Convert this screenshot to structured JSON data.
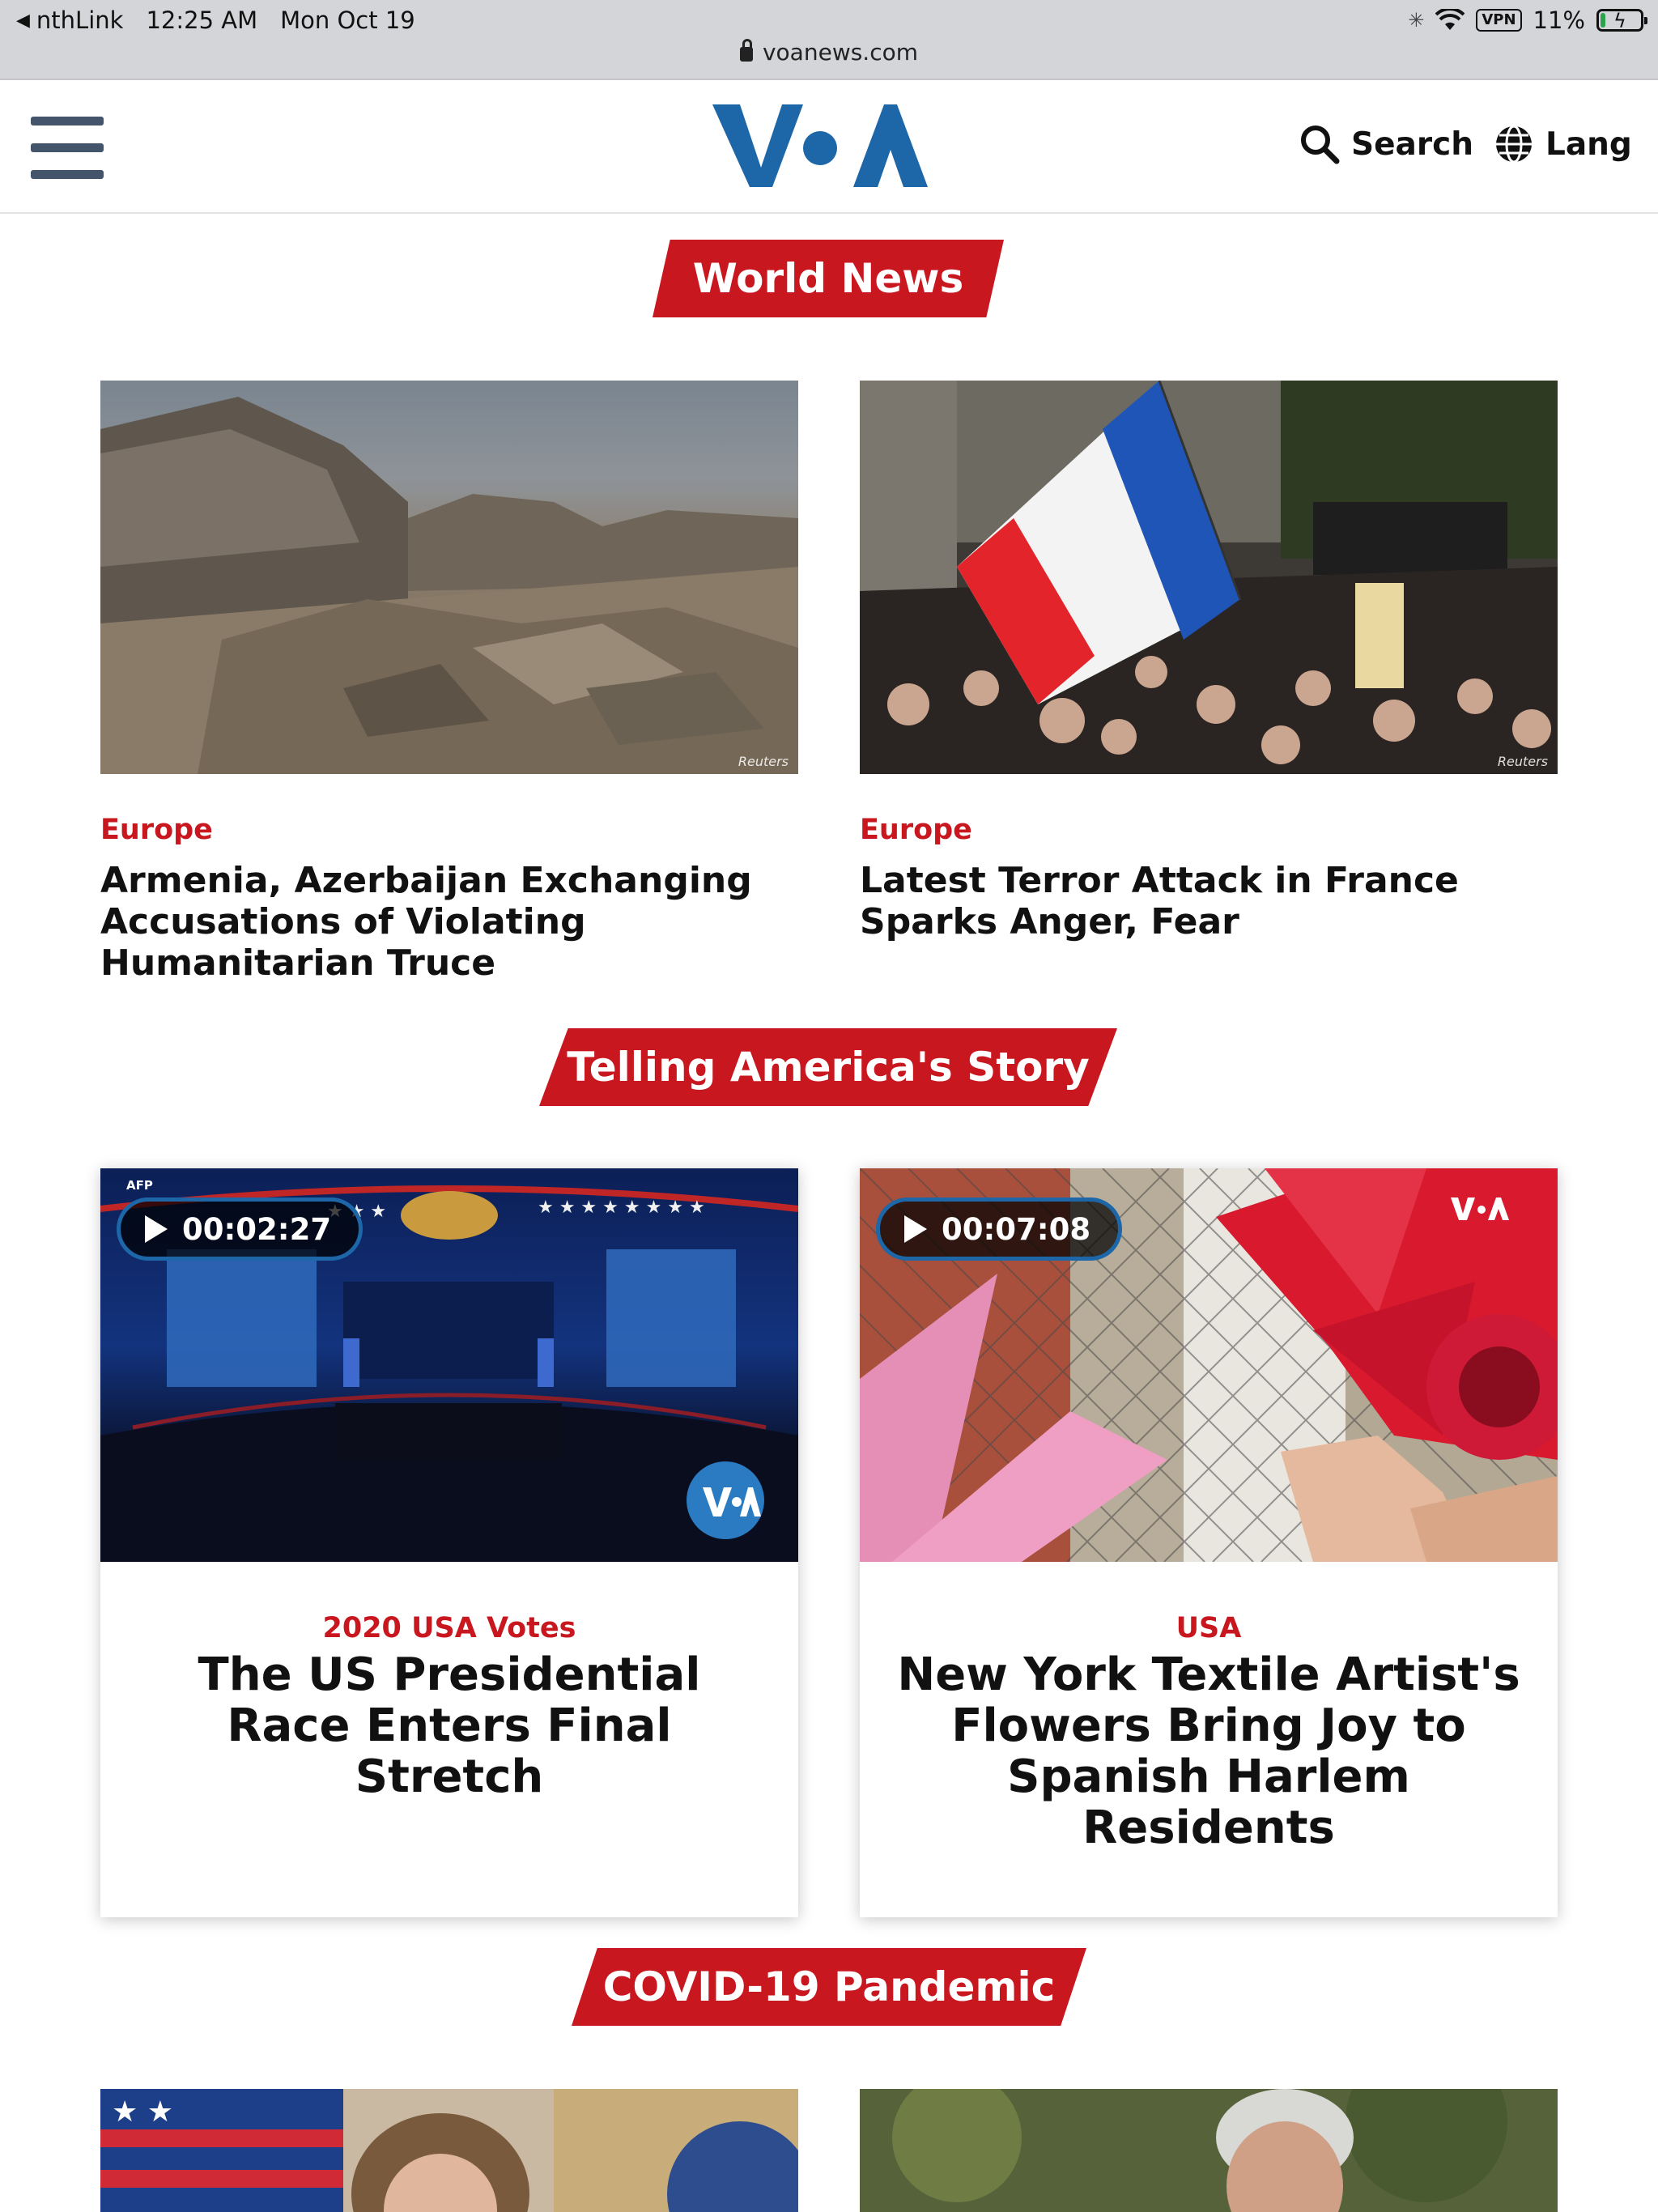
{
  "status_bar": {
    "back_app": "nthLink",
    "time": "12:25 AM",
    "date": "Mon Oct 19",
    "url": "voanews.com",
    "vpn": "VPN",
    "battery": "11%",
    "battery_level": 0.11
  },
  "header": {
    "logo_text": "VOA",
    "search_label": "Search",
    "lang_label": "Lang"
  },
  "sections": [
    {
      "title": "World News",
      "articles": [
        {
          "category": "Europe",
          "headline": "Armenia, Azerbaijan Exchanging Accusations of Violating Humanitarian Truce",
          "credit": "Reuters"
        },
        {
          "category": "Europe",
          "headline": "Latest Terror Attack in France Sparks Anger, Fear",
          "credit": "Reuters"
        }
      ]
    },
    {
      "title": "Telling America's Story",
      "articles": [
        {
          "category": "2020 USA Votes",
          "headline": "The US Presidential Race Enters Final Stretch",
          "duration": "00:02:27",
          "credit": "AFP"
        },
        {
          "category": "USA",
          "headline": "New York Textile Artist's Flowers Bring Joy to Spanish Harlem Residents",
          "duration": "00:07:08"
        }
      ]
    },
    {
      "title": "COVID-19 Pandemic",
      "articles": []
    }
  ],
  "colors": {
    "brand_red": "#c8171e",
    "voa_blue": "#1d67a8",
    "menu_slate": "#44546a"
  }
}
